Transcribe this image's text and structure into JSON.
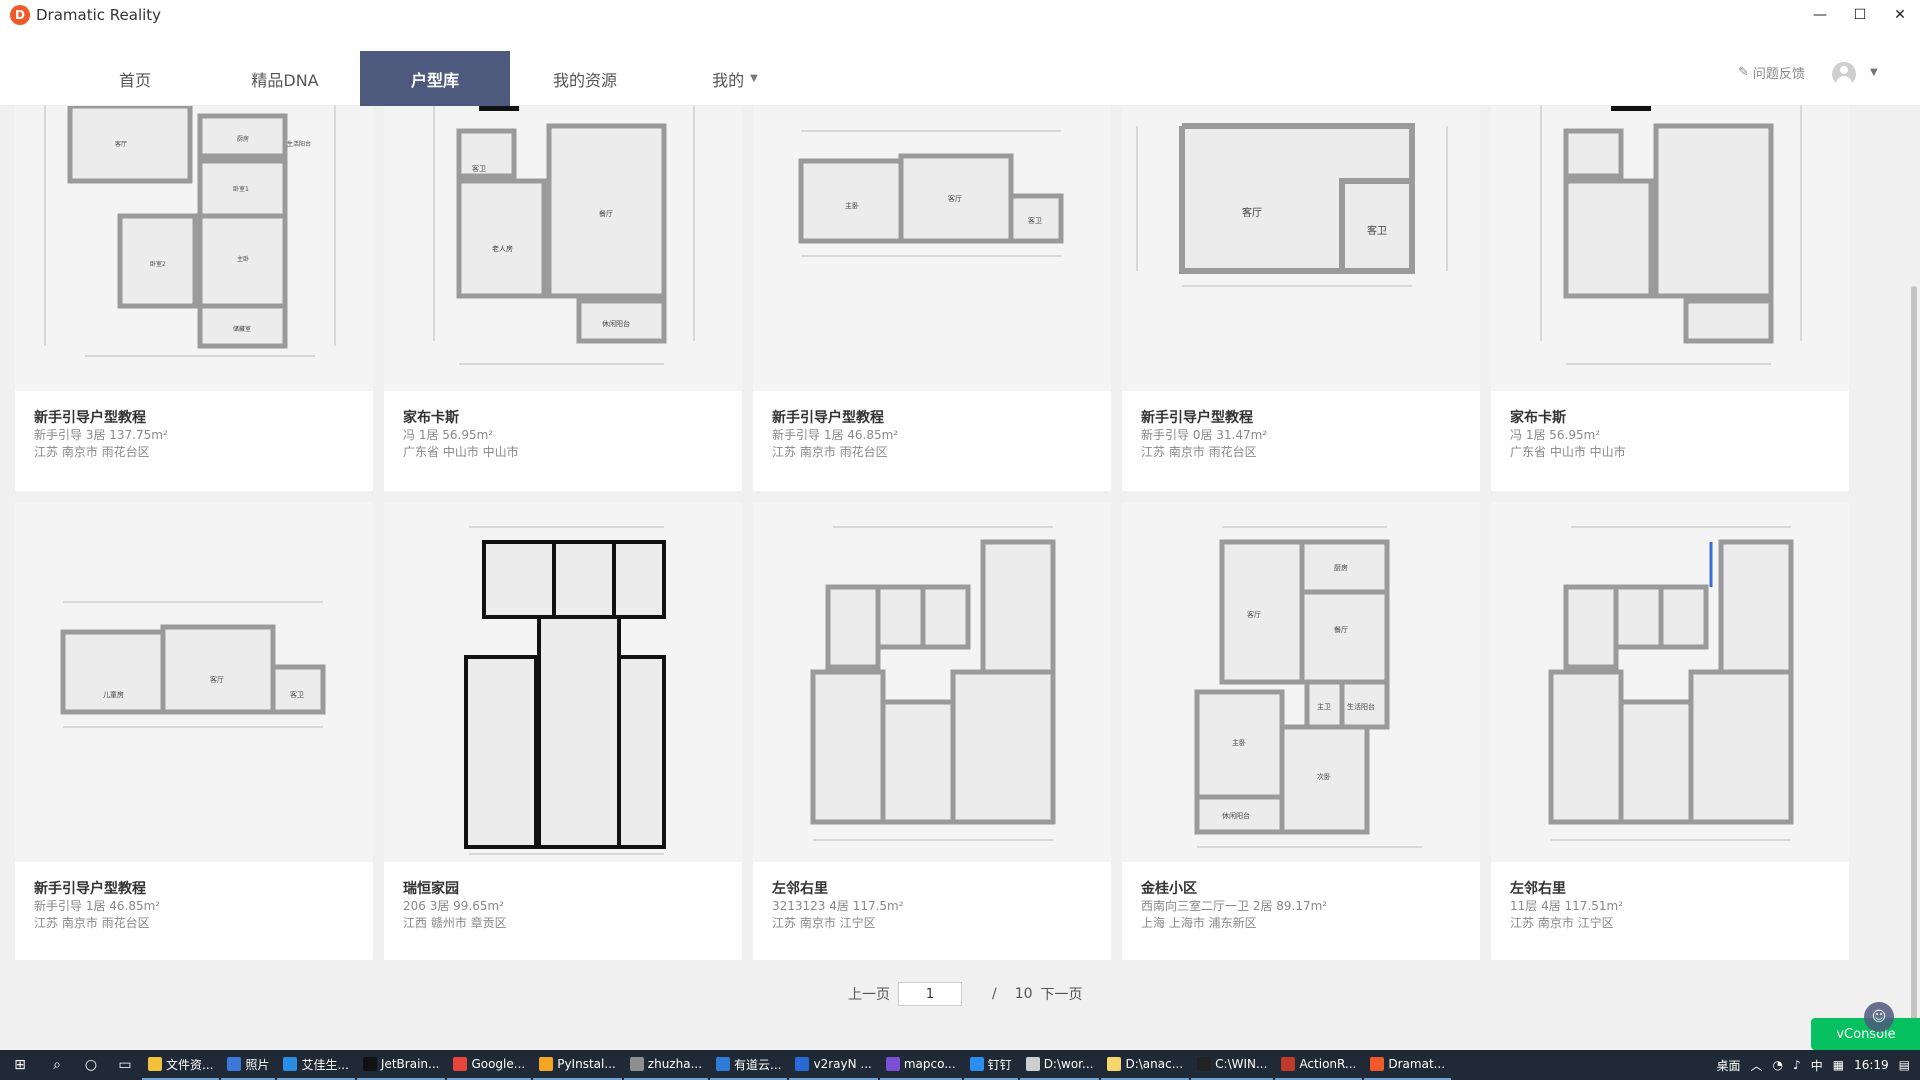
{
  "window": {
    "title": "Dramatic Reality",
    "logo_letter": "D",
    "minimize": "—",
    "maximize": "☐",
    "close": "✕"
  },
  "nav": {
    "tabs": [
      {
        "label": "首页"
      },
      {
        "label": "精品DNA"
      },
      {
        "label": "户型库"
      },
      {
        "label": "我的资源"
      },
      {
        "label": "我的"
      }
    ],
    "active_tab": "户型库",
    "feedback": "问题反馈",
    "accent_color": "#4e5a7d"
  },
  "cards": [
    {
      "title": "新手引导户型教程",
      "meta": "新手引导  3居  137.75m²",
      "addr": "江苏 南京市 雨花台区"
    },
    {
      "title": "家布卡斯",
      "meta": "冯  1居  56.95m²",
      "addr": "广东省 中山市 中山市"
    },
    {
      "title": "新手引导户型教程",
      "meta": "新手引导  1居  46.85m²",
      "addr": "江苏 南京市 雨花台区"
    },
    {
      "title": "新手引导户型教程",
      "meta": "新手引导  0居  31.47m²",
      "addr": "江苏 南京市 雨花台区"
    },
    {
      "title": "家布卡斯",
      "meta": "冯  1居  56.95m²",
      "addr": "广东省 中山市 中山市"
    },
    {
      "title": "新手引导户型教程",
      "meta": "新手引导  1居  46.85m²",
      "addr": "江苏 南京市 雨花台区"
    },
    {
      "title": "瑞恒家园",
      "meta": "206  3居  99.65m²",
      "addr": "江西 赣州市 章贡区"
    },
    {
      "title": "左邻右里",
      "meta": "3213123  4居  117.5m²",
      "addr": "江苏 南京市 江宁区"
    },
    {
      "title": "金桂小区",
      "meta": "西南向三室二厅一卫  2居  89.17m²",
      "addr": "上海 上海市 浦东新区"
    },
    {
      "title": "左邻右里",
      "meta": "11层  4居  117.51m²",
      "addr": "江苏 南京市 江宁区"
    }
  ],
  "plan_labels": {
    "p0": [
      "客厅",
      "厨房",
      "卧室1",
      "卧室2",
      "主卧",
      "生活阳台",
      "储藏室"
    ],
    "p1": [
      "客卫",
      "老人房",
      "餐厅",
      "休闲阳台"
    ],
    "p2": [
      "主卧",
      "客厅",
      "客卫"
    ],
    "p3": [
      "客厅",
      "客卫"
    ],
    "p5": [
      "儿童房",
      "客厅",
      "客卫"
    ],
    "p8": [
      "客厅",
      "厨房",
      "餐厅",
      "主卫",
      "生活阳台",
      "主卧",
      "次卧",
      "休闲阳台"
    ]
  },
  "pager": {
    "prev": "上一页",
    "current": "1",
    "sep": "/",
    "total": "10",
    "next": "下一页"
  },
  "vconsole": "vConsole",
  "taskbar": {
    "apps": [
      {
        "label": "文件资...",
        "color": "#f3c13a"
      },
      {
        "label": "照片",
        "color": "#3b78d8"
      },
      {
        "label": "艾佳生...",
        "color": "#2b8ee6"
      },
      {
        "label": "JetBrain...",
        "color": "#111111"
      },
      {
        "label": "Google...",
        "color": "#e8453c"
      },
      {
        "label": "PyInstal...",
        "color": "#f5a623"
      },
      {
        "label": "zhuzha...",
        "color": "#8e8e8e"
      },
      {
        "label": "有道云...",
        "color": "#2f7bd8"
      },
      {
        "label": "v2rayN ...",
        "color": "#2a6ad6"
      },
      {
        "label": "mapco...",
        "color": "#7b4fd6"
      },
      {
        "label": "钉钉",
        "color": "#2a8ef0"
      },
      {
        "label": "D:\\wor...",
        "color": "#cfcfcf"
      },
      {
        "label": "D:\\anac...",
        "color": "#f5d76e"
      },
      {
        "label": "C:\\WIN...",
        "color": "#222222"
      },
      {
        "label": "ActionR...",
        "color": "#c0392b"
      },
      {
        "label": "Dramat...",
        "color": "#f05a28"
      }
    ],
    "desktop": "桌面",
    "ime": "中",
    "time": "16:19"
  }
}
